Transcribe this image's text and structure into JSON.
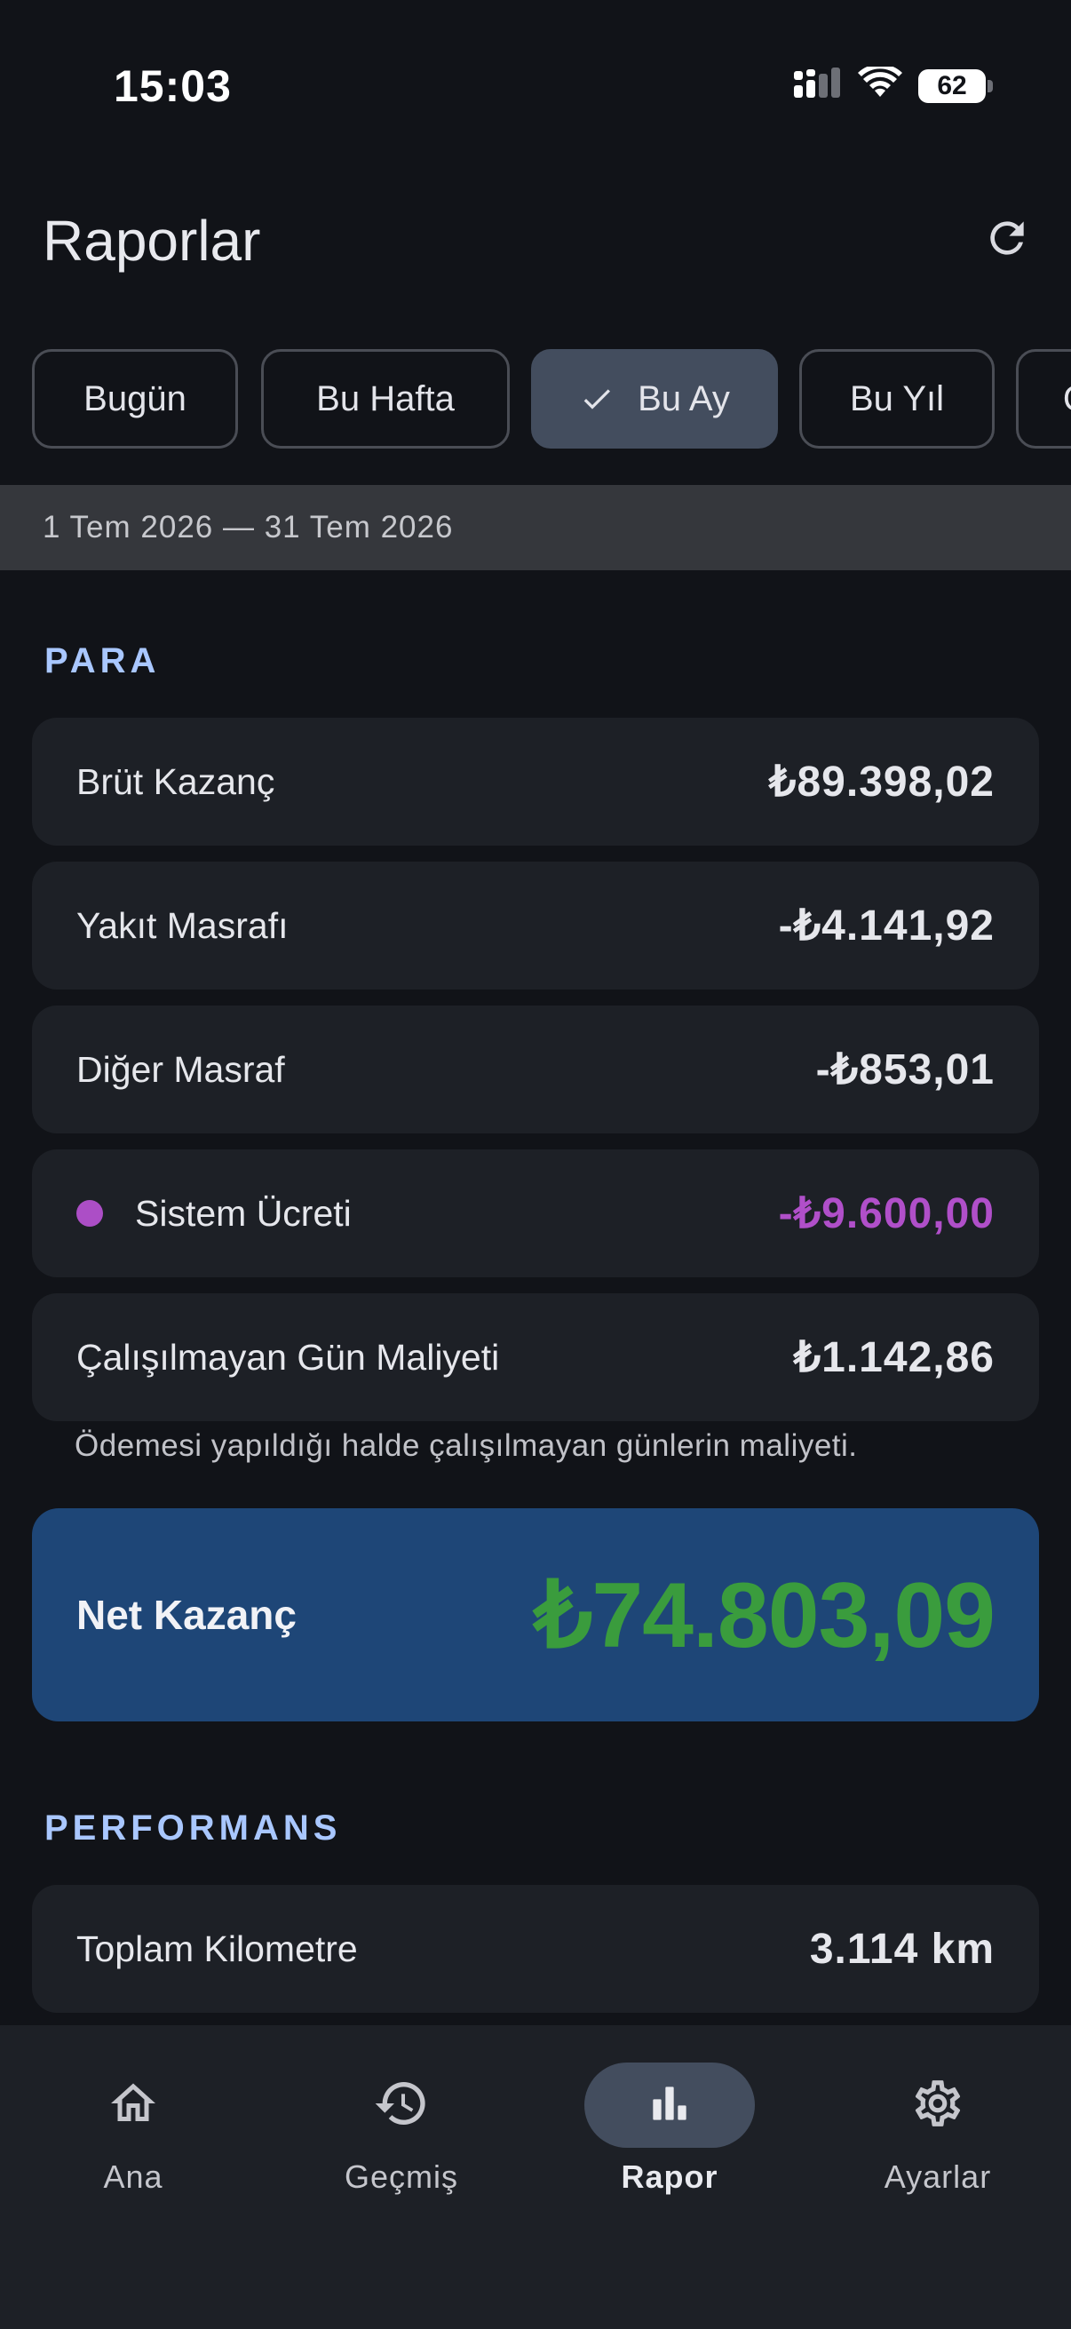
{
  "status_bar": {
    "time": "15:03",
    "battery": "62"
  },
  "header": {
    "title": "Raporlar",
    "refresh_icon": "refresh-icon"
  },
  "filters": {
    "chips": [
      {
        "label": "Bugün",
        "selected": false
      },
      {
        "label": "Bu Hafta",
        "selected": false
      },
      {
        "label": "Bu Ay",
        "selected": true
      },
      {
        "label": "Bu Yıl",
        "selected": false
      },
      {
        "label": "Ö",
        "selected": false
      }
    ]
  },
  "date_range": "1 Tem 2026 — 31 Tem 2026",
  "money_section": {
    "title": "PARA",
    "rows": [
      {
        "label": "Brüt Kazanç",
        "value": "₺89.398,02"
      },
      {
        "label": "Yakıt Masrafı",
        "value": "-₺4.141,92"
      },
      {
        "label": "Diğer Masraf",
        "value": "-₺853,01"
      },
      {
        "label": "Sistem Ücreti",
        "value": "-₺9.600,00"
      },
      {
        "label": "Çalışılmayan Gün Maliyeti",
        "value": "₺1.142,86"
      }
    ],
    "note": "Ödemesi yapıldığı halde çalışılmayan günlerin maliyeti.",
    "net": {
      "label": "Net Kazanç",
      "value": "₺74.803,09"
    }
  },
  "performance_section": {
    "title": "PERFORMANS",
    "rows": [
      {
        "label": "Toplam Kilometre",
        "value": "3.114 km"
      }
    ]
  },
  "bottom_nav": {
    "items": [
      {
        "label": "Ana",
        "icon": "home-icon"
      },
      {
        "label": "Geçmiş",
        "icon": "history-icon"
      },
      {
        "label": "Rapor",
        "icon": "bar-chart-icon",
        "active": true
      },
      {
        "label": "Ayarlar",
        "icon": "settings-icon"
      }
    ]
  },
  "colors": {
    "background": "#111318",
    "accent": "#a9c7ff",
    "card": "#1d2026",
    "net_card": "#1e4677",
    "net_value": "#3a9c3d",
    "system_fee": "#b04fc9"
  }
}
